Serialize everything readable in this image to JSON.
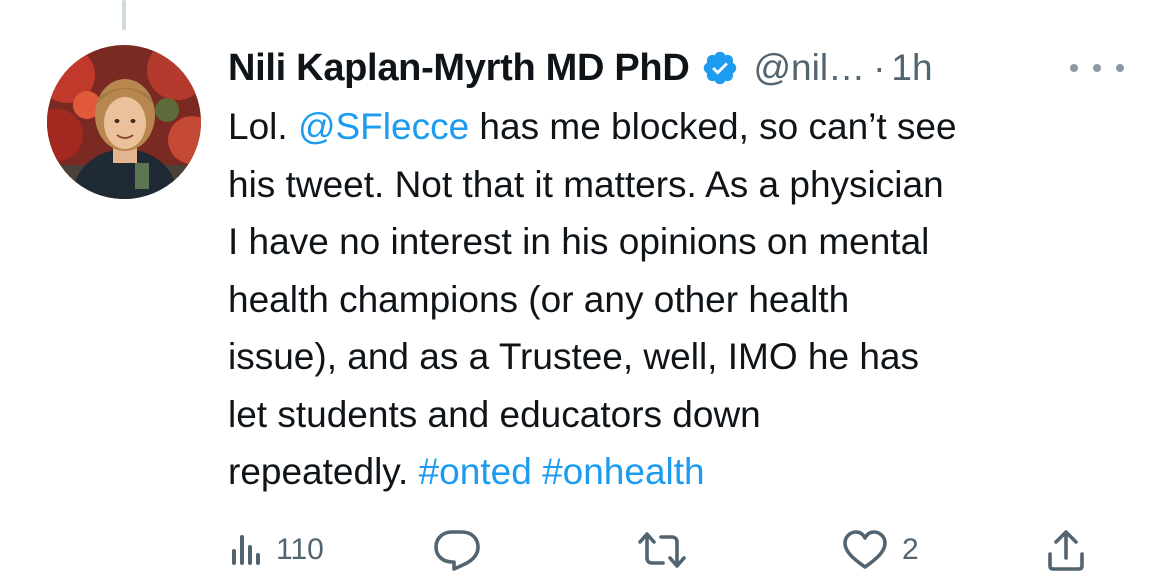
{
  "tweet": {
    "display_name": "Nili Kaplan-Myrth MD PhD",
    "handle": "@nil…",
    "separator": "·",
    "time": "1h",
    "verified": true,
    "text_lines": [
      [
        {
          "t": "Lol. "
        },
        {
          "t": "@SFlecce",
          "link": true
        },
        {
          "t": " has me blocked, so can’t see"
        }
      ],
      [
        {
          "t": "his tweet. Not that it matters. As a physician"
        }
      ],
      [
        {
          "t": "I have no interest in his opinions on mental"
        }
      ],
      [
        {
          "t": "health champions (or any other health"
        }
      ],
      [
        {
          "t": "issue), and as a Trustee, well, IMO he has"
        }
      ],
      [
        {
          "t": "let students and educators down"
        }
      ],
      [
        {
          "t": "repeatedly. "
        },
        {
          "t": "#onted",
          "link": true
        },
        {
          "t": " "
        },
        {
          "t": "#onhealth",
          "link": true
        }
      ]
    ]
  },
  "actions": {
    "views": {
      "icon": "views-icon",
      "count": "110"
    },
    "reply": {
      "icon": "reply-icon",
      "count": ""
    },
    "retweet": {
      "icon": "retweet-icon",
      "count": ""
    },
    "like": {
      "icon": "heart-icon",
      "count": "2"
    },
    "share": {
      "icon": "share-icon",
      "count": ""
    }
  },
  "colors": {
    "link": "#1d9bf0",
    "muted": "#536471",
    "verified": "#1d9bf0",
    "text": "#0f1419"
  }
}
